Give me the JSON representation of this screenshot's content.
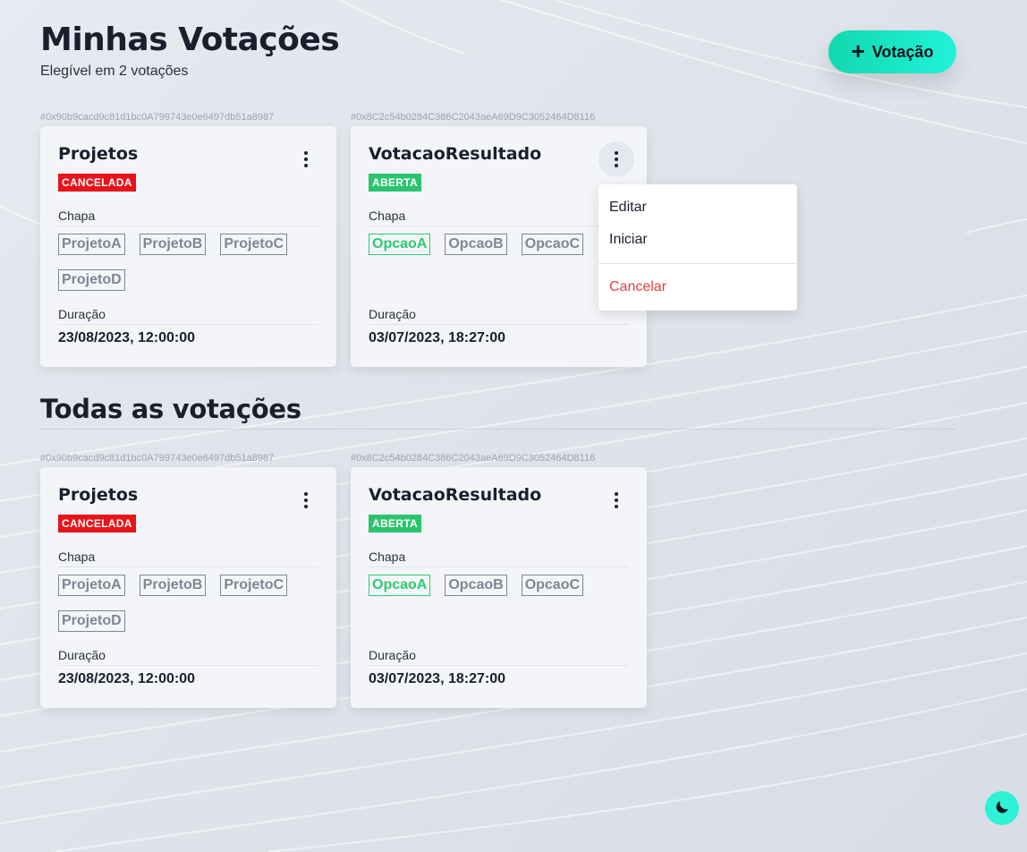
{
  "header": {
    "title": "Minhas Votações",
    "subtitle": "Elegível em 2 votações",
    "new_vote_label": "Votação"
  },
  "my_votes": [
    {
      "address": "#0x90b9cacd9c81d1bc0A799743e0e6497db51a8987",
      "title": "Projetos",
      "status": "CANCELADA",
      "chapa_label": "Chapa",
      "options": [
        "ProjetoA",
        "ProjetoB",
        "ProjetoC",
        "ProjetoD"
      ],
      "duration_label": "Duração",
      "date": "23/08/2023, 12:00:00"
    },
    {
      "address": "#0x8C2c54b0284C386C2043aeA69D9C3052464D8116",
      "title": "VotacaoResultado",
      "status": "ABERTA",
      "chapa_label": "Chapa",
      "options": [
        "OpcaoA",
        "OpcaoB",
        "OpcaoC"
      ],
      "duration_label": "Duração",
      "date": "03/07/2023, 18:27:00"
    }
  ],
  "all_votes_title": "Todas as votações",
  "all_votes": [
    {
      "address": "#0x90b9cacd9c81d1bc0A799743e0e6497db51a8987",
      "title": "Projetos",
      "status": "CANCELADA",
      "chapa_label": "Chapa",
      "options": [
        "ProjetoA",
        "ProjetoB",
        "ProjetoC",
        "ProjetoD"
      ],
      "duration_label": "Duração",
      "date": "23/08/2023, 12:00:00"
    },
    {
      "address": "#0x8C2c54b0284C386C2043aeA69D9C3052464D8116",
      "title": "VotacaoResultado",
      "status": "ABERTA",
      "chapa_label": "Chapa",
      "options": [
        "OpcaoA",
        "OpcaoB",
        "OpcaoC"
      ],
      "duration_label": "Duração",
      "date": "03/07/2023, 18:27:00"
    }
  ],
  "dropdown": {
    "edit": "Editar",
    "start": "Iniciar",
    "cancel": "Cancelar"
  },
  "colors": {
    "accent": "#20f2d8",
    "cancelada": "#e8141b",
    "aberta": "#2ac46f",
    "danger": "#e53e3e"
  },
  "icons": {
    "add": "plus-icon",
    "menu": "more-vertical-icon",
    "theme": "moon-icon"
  }
}
